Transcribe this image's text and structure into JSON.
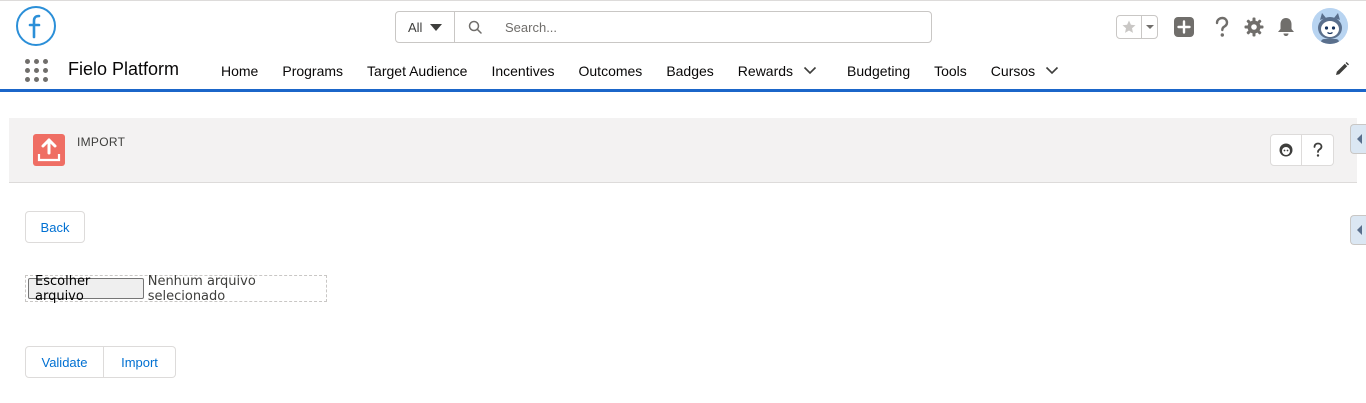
{
  "header": {
    "search": {
      "scope": "All",
      "placeholder": "Search..."
    },
    "icons": [
      "star-icon",
      "add-icon",
      "help-icon",
      "setup-gear-icon",
      "notifications-bell-icon"
    ]
  },
  "context": {
    "app_name": "Fielo Platform",
    "nav_items": [
      {
        "label": "Home",
        "has_menu": false
      },
      {
        "label": "Programs",
        "has_menu": false
      },
      {
        "label": "Target Audience",
        "has_menu": false
      },
      {
        "label": "Incentives",
        "has_menu": false
      },
      {
        "label": "Outcomes",
        "has_menu": false
      },
      {
        "label": "Badges",
        "has_menu": false
      },
      {
        "label": "Rewards",
        "has_menu": true
      },
      {
        "label": "Budgeting",
        "has_menu": false
      },
      {
        "label": "Tools",
        "has_menu": false
      },
      {
        "label": "Cursos",
        "has_menu": true
      }
    ]
  },
  "page": {
    "title": "IMPORT",
    "back_label": "Back",
    "file_button_label": "Escolher arquivo",
    "file_status": "Nenhum arquivo selecionado",
    "validate_label": "Validate",
    "import_label": "Import"
  },
  "colors": {
    "brand_blue": "#1b66c9",
    "link_blue": "#0070d2",
    "import_icon_bg": "#ef6e64"
  }
}
